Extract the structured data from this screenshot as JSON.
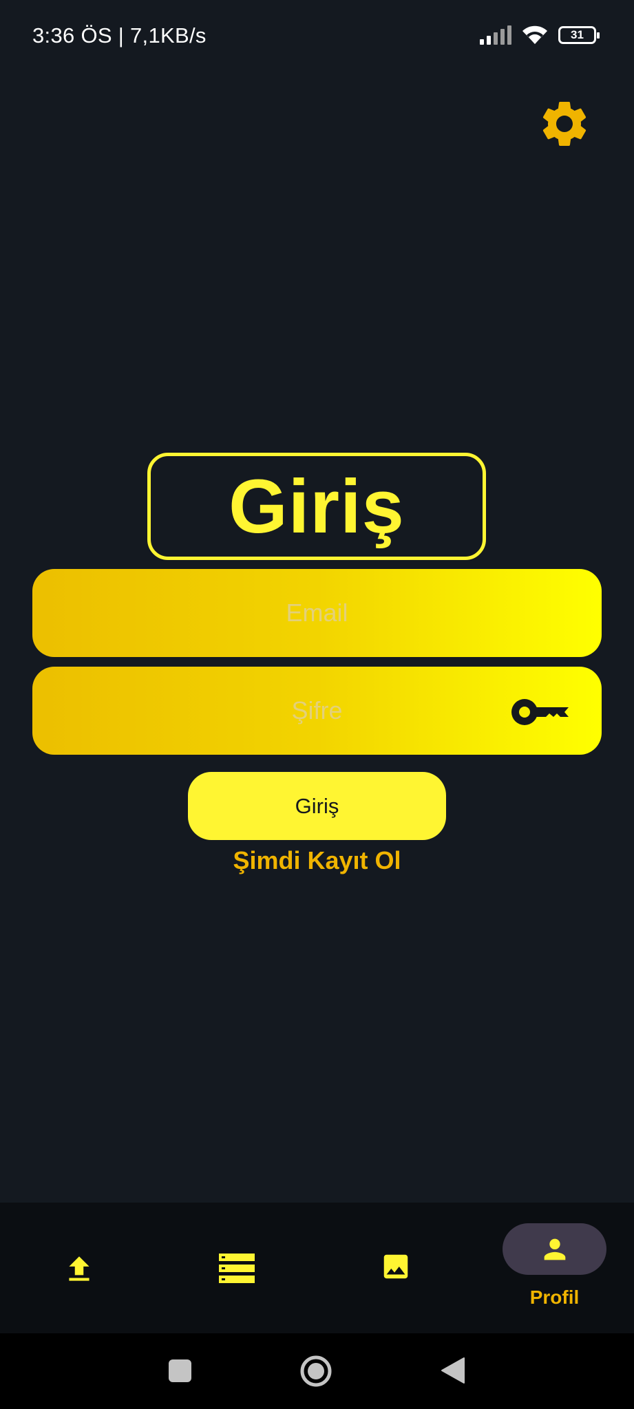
{
  "status_bar": {
    "text": "3:36 ÖS | 7,1KB/s",
    "battery": "31"
  },
  "header": {
    "settings_icon": "gear-icon"
  },
  "login": {
    "title": "Giriş",
    "email_placeholder": "Email",
    "password_placeholder": "Şifre",
    "password_icon": "key-icon",
    "submit_label": "Giriş",
    "register_label": "Şimdi Kayıt Ol"
  },
  "bottom_nav": {
    "items": [
      {
        "icon": "upload-icon",
        "label": ""
      },
      {
        "icon": "list-icon",
        "label": ""
      },
      {
        "icon": "image-icon",
        "label": ""
      },
      {
        "icon": "person-icon",
        "label": "Profil",
        "active": true
      }
    ]
  },
  "colors": {
    "background": "#141920",
    "accent": "#fff532",
    "accent_dark": "#f0b400",
    "nav_background": "#0b0e12",
    "active_pill": "#403a4c"
  }
}
